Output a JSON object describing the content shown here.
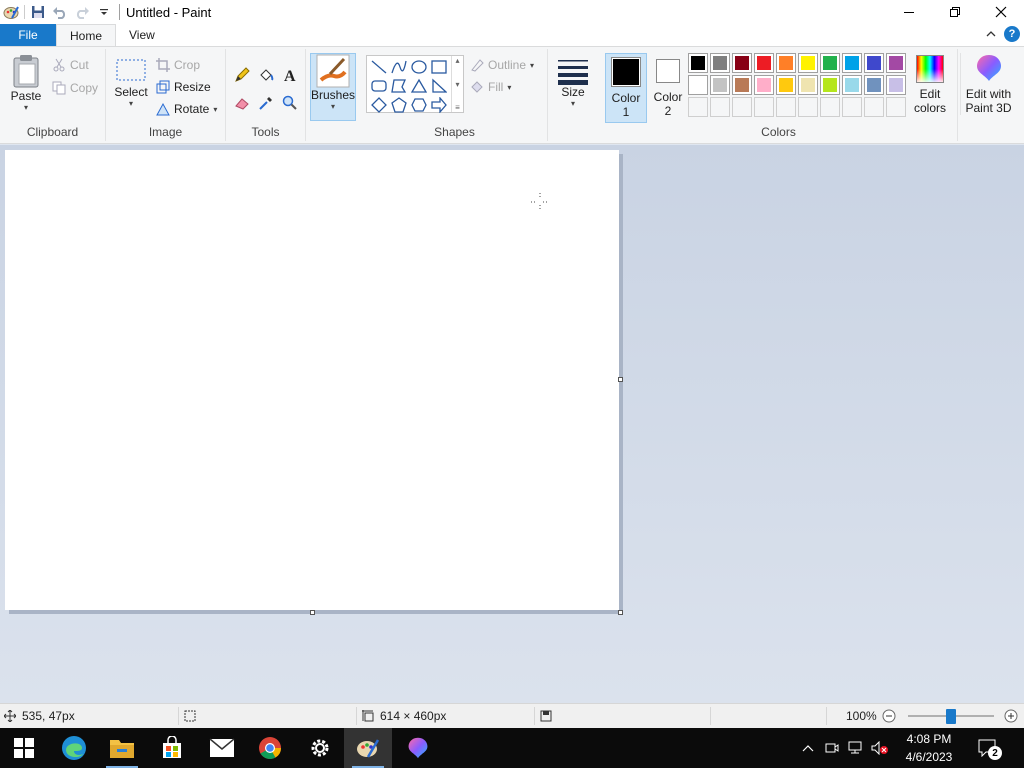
{
  "window": {
    "title": "Untitled - Paint"
  },
  "tabs": {
    "file": "File",
    "home": "Home",
    "view": "View"
  },
  "ribbon": {
    "clipboard": {
      "paste": "Paste",
      "cut": "Cut",
      "copy": "Copy",
      "label": "Clipboard"
    },
    "image": {
      "select": "Select",
      "crop": "Crop",
      "resize": "Resize",
      "rotate": "Rotate",
      "label": "Image"
    },
    "tools": {
      "label": "Tools"
    },
    "brushes": {
      "label": "Brushes"
    },
    "shapes": {
      "outline": "Outline",
      "fill": "Fill",
      "label": "Shapes"
    },
    "size": {
      "label": "Size"
    },
    "colors": {
      "color1": "Color",
      "color1_num": "1",
      "color2": "Color",
      "color2_num": "2",
      "edit_colors_1": "Edit",
      "edit_colors_2": "colors",
      "label": "Colors",
      "color1_value": "#000000",
      "color2_value": "#ffffff",
      "palette": [
        "#000000",
        "#7f7f7f",
        "#880015",
        "#ed1c24",
        "#ff7f27",
        "#fff200",
        "#22b14c",
        "#00a2e8",
        "#3f48cc",
        "#a349a4",
        "#ffffff",
        "#c3c3c3",
        "#b97a57",
        "#ffaec9",
        "#ffc90e",
        "#efe4b0",
        "#b5e61d",
        "#99d9ea",
        "#7092be",
        "#c8bfe7"
      ]
    },
    "paint3d": {
      "line1": "Edit with",
      "line2": "Paint 3D"
    }
  },
  "status": {
    "cursor_pos": "535, 47px",
    "canvas_size": "614 × 460px",
    "zoom": "100%"
  },
  "taskbar": {
    "time": "4:08 PM",
    "date": "4/6/2023",
    "notifications": "2"
  },
  "icons": {
    "start": "windows-logo-icon",
    "edge": "edge-icon",
    "explorer": "file-explorer-icon",
    "store": "store-icon",
    "mail": "mail-icon",
    "chrome": "chrome-icon",
    "settings": "settings-icon",
    "paint": "paint-icon",
    "paint3d": "paint-3d-icon"
  }
}
